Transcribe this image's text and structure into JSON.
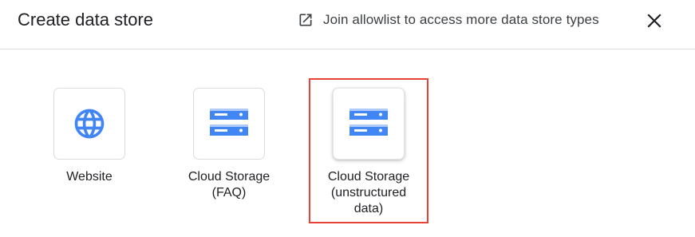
{
  "dialog": {
    "title": "Create data store",
    "allowlist_link": {
      "label": "Join allowlist to access more data store types",
      "icon": "open-in-new-icon"
    },
    "close_icon": "close-icon"
  },
  "options": [
    {
      "label": "Website",
      "icon": "globe-icon"
    },
    {
      "label": "Cloud Storage\n(FAQ)",
      "icon": "storage-icon"
    },
    {
      "label": "Cloud Storage\n(unstructured\ndata)",
      "icon": "storage-icon",
      "highlighted": true
    }
  ],
  "colors": {
    "icon_blue": "#4285f4",
    "icon_blue_light": "#aecbfa",
    "highlight_red": "#ea4335",
    "border_gray": "#dadce0"
  }
}
